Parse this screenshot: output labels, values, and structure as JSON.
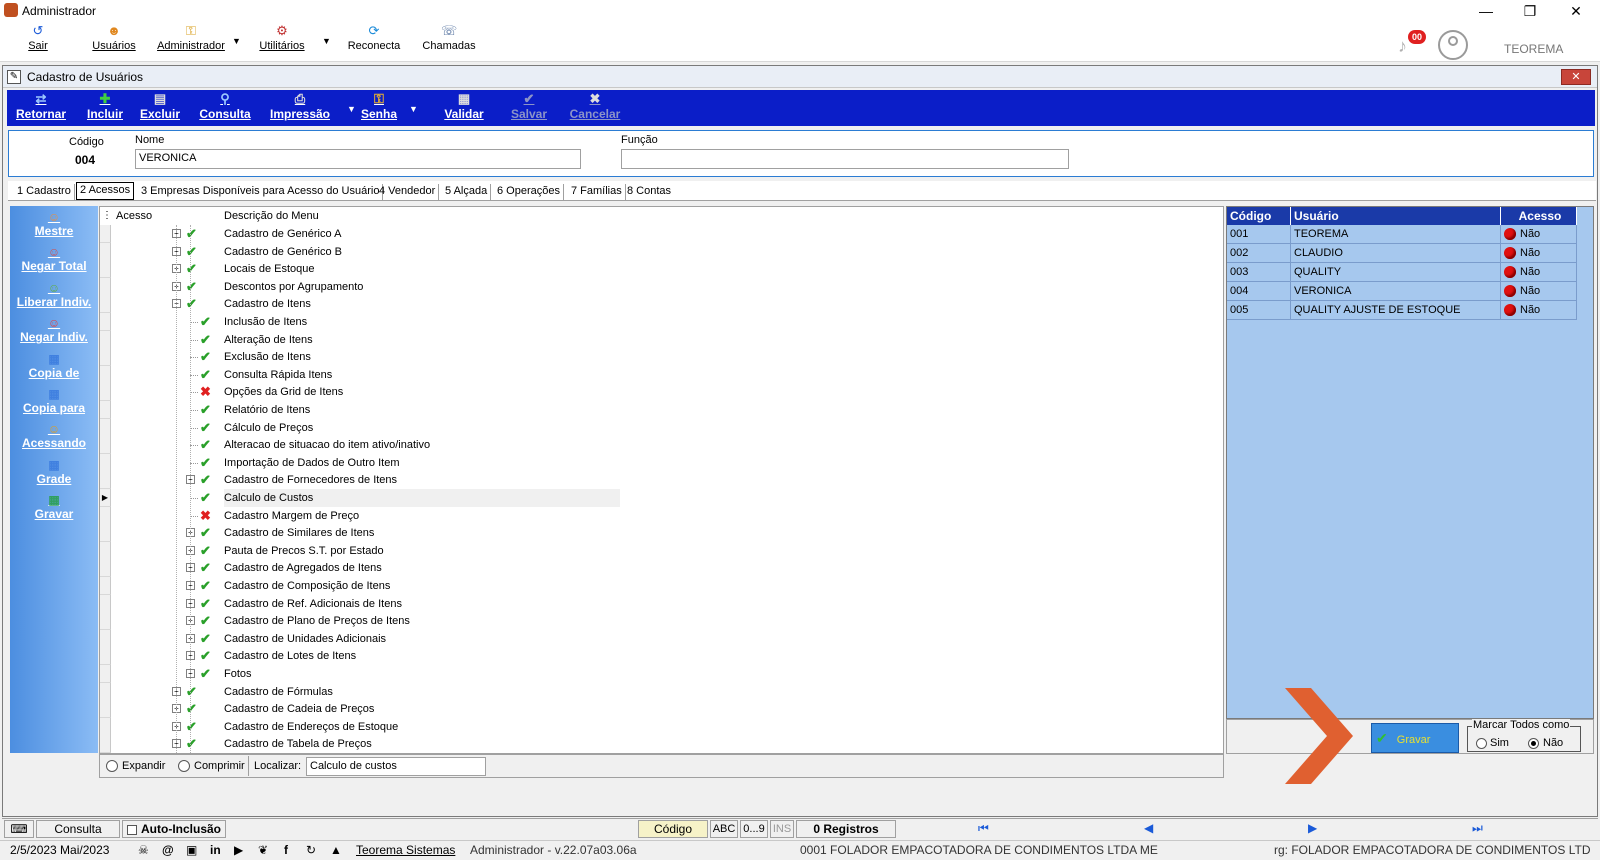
{
  "window": {
    "title": "Administrador"
  },
  "main_toolbar": {
    "items": [
      {
        "label": "Sair",
        "icon": "exit-icon"
      },
      {
        "label": "Usuários",
        "icon": "users-icon"
      },
      {
        "label": "Administrador",
        "icon": "key-icon"
      },
      {
        "label": "Utilitários",
        "icon": "tools-icon"
      },
      {
        "label": "Reconecta",
        "icon": "reconnect-icon"
      },
      {
        "label": "Chamadas",
        "icon": "calls-icon"
      }
    ],
    "notif_count": "00",
    "company": "TEOREMA"
  },
  "child": {
    "title": "Cadastro de Usuários",
    "toolbar": {
      "items": [
        {
          "label": "Retornar",
          "icon": "back-icon",
          "enabled": true
        },
        {
          "label": "Incluir",
          "icon": "plus-icon",
          "enabled": true
        },
        {
          "label": "Excluir",
          "icon": "delete-icon",
          "enabled": true
        },
        {
          "label": "Consulta",
          "icon": "search-icon",
          "enabled": true
        },
        {
          "label": "Impressão",
          "icon": "printer-icon",
          "enabled": true
        },
        {
          "label": "Senha",
          "icon": "key-icon",
          "enabled": true
        },
        {
          "label": "Validar",
          "icon": "grid-icon",
          "enabled": true
        },
        {
          "label": "Salvar",
          "icon": "check-icon",
          "enabled": false
        },
        {
          "label": "Cancelar",
          "icon": "x-icon",
          "enabled": false
        }
      ]
    },
    "header": {
      "codigo_label": "Código",
      "codigo_value": "004",
      "nome_label": "Nome",
      "nome_value": "VERONICA",
      "funcao_label": "Função",
      "funcao_value": ""
    },
    "tabs": [
      "1 Cadastro",
      "2 Acessos",
      "3 Empresas Disponíveis para Acesso do Usuário",
      "4 Vendedor",
      "5 Alçada",
      "6 Operações",
      "7 Famílias",
      "8 Contas"
    ],
    "side_buttons": [
      {
        "label": "Mestre",
        "icon": "user-icon"
      },
      {
        "label": "Negar Total",
        "icon": "deny-icon"
      },
      {
        "label": "Liberar Indiv.",
        "icon": "user-check-icon"
      },
      {
        "label": "Negar Indiv.",
        "icon": "user-x-icon"
      },
      {
        "label": "Copia de",
        "icon": "grid-icon"
      },
      {
        "label": "Copia para",
        "icon": "grid-icon"
      },
      {
        "label": "Acessando",
        "icon": "users-icon"
      },
      {
        "label": "Grade",
        "icon": "grade-icon"
      },
      {
        "label": "Gravar",
        "icon": "save-icon"
      }
    ],
    "tree": {
      "col_acesso": "Acesso",
      "col_desc": "Descrição do Menu",
      "rows": [
        {
          "label": "Cadastro de Genérico A",
          "level": 1,
          "expander": "+",
          "status": "ok"
        },
        {
          "label": "Cadastro de Genérico B",
          "level": 1,
          "expander": "+",
          "status": "ok"
        },
        {
          "label": "Locais de Estoque",
          "level": 1,
          "expander": "+",
          "status": "ok"
        },
        {
          "label": "Descontos por Agrupamento",
          "level": 1,
          "expander": "+",
          "status": "ok"
        },
        {
          "label": "Cadastro de Itens",
          "level": 1,
          "expander": "-",
          "status": "ok"
        },
        {
          "label": "Inclusão de Itens",
          "level": 2,
          "expander": "",
          "status": "ok"
        },
        {
          "label": "Alteração de Itens",
          "level": 2,
          "expander": "",
          "status": "ok"
        },
        {
          "label": "Exclusão de Itens",
          "level": 2,
          "expander": "",
          "status": "ok"
        },
        {
          "label": "Consulta Rápida Itens",
          "level": 2,
          "expander": "",
          "status": "ok"
        },
        {
          "label": "Opções da Grid de Itens",
          "level": 2,
          "expander": "",
          "status": "denied"
        },
        {
          "label": "Relatório de Itens",
          "level": 2,
          "expander": "",
          "status": "ok"
        },
        {
          "label": "Cálculo de Preços",
          "level": 2,
          "expander": "",
          "status": "ok"
        },
        {
          "label": "Alteracao de situacao do item ativo/inativo",
          "level": 2,
          "expander": "",
          "status": "ok"
        },
        {
          "label": "Importação de Dados de Outro Item",
          "level": 2,
          "expander": "",
          "status": "ok"
        },
        {
          "label": "Cadastro de Fornecedores de Itens",
          "level": 2,
          "expander": "+",
          "status": "ok"
        },
        {
          "label": "Calculo de Custos",
          "level": 2,
          "expander": "",
          "status": "ok",
          "selected": true
        },
        {
          "label": "Cadastro Margem de Preço",
          "level": 2,
          "expander": "",
          "status": "denied"
        },
        {
          "label": "Cadastro de Similares de Itens",
          "level": 2,
          "expander": "+",
          "status": "ok"
        },
        {
          "label": "Pauta de Precos S.T. por Estado",
          "level": 2,
          "expander": "+",
          "status": "ok"
        },
        {
          "label": "Cadastro de Agregados de Itens",
          "level": 2,
          "expander": "+",
          "status": "ok"
        },
        {
          "label": "Cadastro de Composição de Itens",
          "level": 2,
          "expander": "+",
          "status": "ok"
        },
        {
          "label": "Cadastro de Ref. Adicionais de Itens",
          "level": 2,
          "expander": "+",
          "status": "ok"
        },
        {
          "label": "Cadastro de Plano de Preços de Itens",
          "level": 2,
          "expander": "+",
          "status": "ok"
        },
        {
          "label": "Cadastro de Unidades Adicionais",
          "level": 2,
          "expander": "+",
          "status": "ok"
        },
        {
          "label": "Cadastro de Lotes de Itens",
          "level": 2,
          "expander": "+",
          "status": "ok"
        },
        {
          "label": "Fotos",
          "level": 2,
          "expander": "+",
          "status": "ok"
        },
        {
          "label": "Cadastro de Fórmulas",
          "level": 1,
          "expander": "+",
          "status": "ok"
        },
        {
          "label": "Cadastro de Cadeia de Preços",
          "level": 1,
          "expander": "+",
          "status": "ok"
        },
        {
          "label": "Cadastro de Endereços de Estoque",
          "level": 1,
          "expander": "+",
          "status": "ok"
        },
        {
          "label": "Cadastro de Tabela de Preços",
          "level": 1,
          "expander": "+",
          "status": "ok"
        }
      ]
    },
    "search": {
      "expandir": "Expandir",
      "comprimir": "Comprimir",
      "localizar_label": "Localizar:",
      "localizar_value": "Calculo de custos"
    },
    "users": {
      "headers": [
        "Código",
        "Usuário",
        "Acesso"
      ],
      "rows": [
        {
          "codigo": "001",
          "usuario": "TEOREMA",
          "acesso": "Não"
        },
        {
          "codigo": "002",
          "usuario": "CLAUDIO",
          "acesso": "Não"
        },
        {
          "codigo": "003",
          "usuario": "QUALITY",
          "acesso": "Não"
        },
        {
          "codigo": "004",
          "usuario": "VERONICA",
          "acesso": "Não"
        },
        {
          "codigo": "005",
          "usuario": "QUALITY AJUSTE DE ESTOQUE",
          "acesso": "Não"
        }
      ],
      "gravar_label": "Gravar",
      "marcar_label": "Marcar Todos como",
      "sim": "Sim",
      "nao": "Não"
    }
  },
  "statusbar": {
    "consulta": "Consulta",
    "auto_inclusao": "Auto-Inclusão",
    "codigo": "Código",
    "abc": "ABC",
    "num": "0...9",
    "ins": "INS",
    "registros": "0 Registros"
  },
  "footer": {
    "date": "2/5/2023 Mai/2023",
    "link": "Teorema Sistemas",
    "version": "Administrador - v.22.07a03.06a",
    "company": "0001 FOLADOR EMPACOTADORA DE CONDIMENTOS LTDA ME",
    "company2": "rg: FOLADOR EMPACOTADORA DE CONDIMENTOS LTD"
  },
  "colors": {
    "blue_toolbar": "#0b1ec8",
    "accent_orange": "#e06030",
    "ok_green": "#2aa02a",
    "deny_red": "#e02020"
  }
}
